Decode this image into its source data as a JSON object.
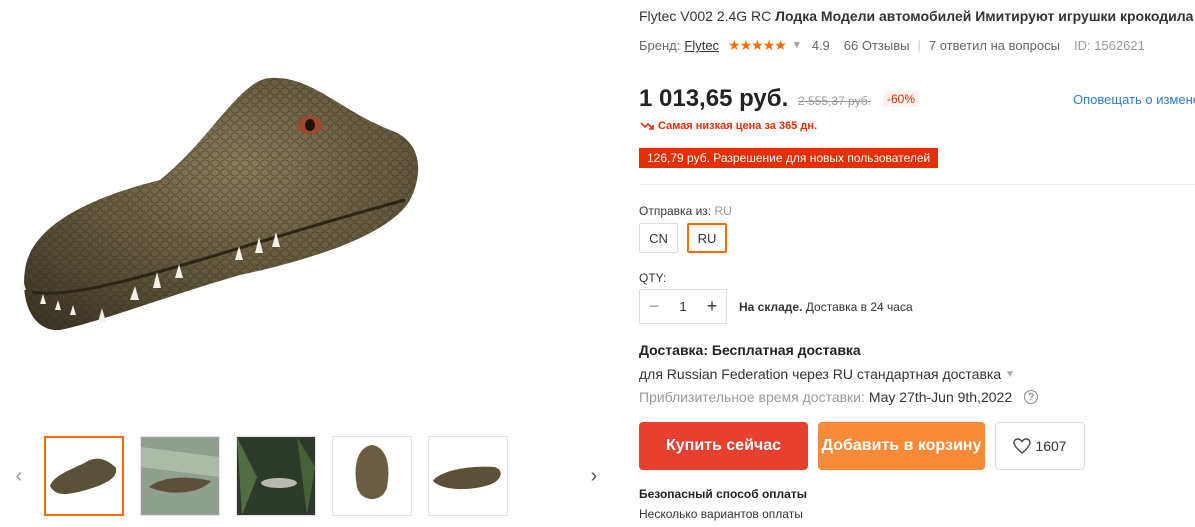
{
  "product": {
    "title_brand": "Flytec V002 2.4G RC",
    "title_rest": "Лодка Модели автомобилей Имитируют игрушки крокодила"
  },
  "meta": {
    "brand_label": "Бренд:",
    "brand_name": "Flytec",
    "stars": "★★★★★",
    "rating": "4.9",
    "reviews": "66 Отзывы",
    "answers": "7 ответил на вопросы",
    "id": "ID: 1562621"
  },
  "price": {
    "current": "1 013,65 руб.",
    "old": "2 555,37 руб.",
    "discount": "-60%",
    "notify": "Оповещать о измене",
    "lowest": "Самая низкая цена за 365 дн.",
    "new_user": "126,79 руб. Разрешение для новых пользователей"
  },
  "ship_from": {
    "label": "Отправка из:",
    "selected": "RU",
    "options": [
      "CN",
      "RU"
    ]
  },
  "qty": {
    "label": "QTY:",
    "minus": "−",
    "value": "1",
    "plus": "+",
    "stock_bold": "На складе.",
    "stock_rest": "Доставка в 24 часа"
  },
  "delivery": {
    "title": "Доставка: Бесплатная доставка",
    "line": "для Russian Federation через RU стандартная доставка",
    "time_label": "Приблизительное время доставки:",
    "time_value": "May 27th-Jun 9th,2022",
    "help": "?"
  },
  "actions": {
    "buy": "Купить сейчас",
    "cart": "Добавить в корзину",
    "wishlist_count": "1607"
  },
  "payment": {
    "title": "Безопасный способ оплаты",
    "subtitle": "Несколько вариантов оплаты"
  },
  "gallery": {
    "prev": "‹",
    "next": "›",
    "thumbnail_count": 5,
    "active_index": 0
  },
  "colors": {
    "accent": "#ff6a00",
    "buy": "#e8402e",
    "cart": "#f98a3a",
    "sale_red": "#e62e04",
    "link": "#2e7bcf"
  }
}
